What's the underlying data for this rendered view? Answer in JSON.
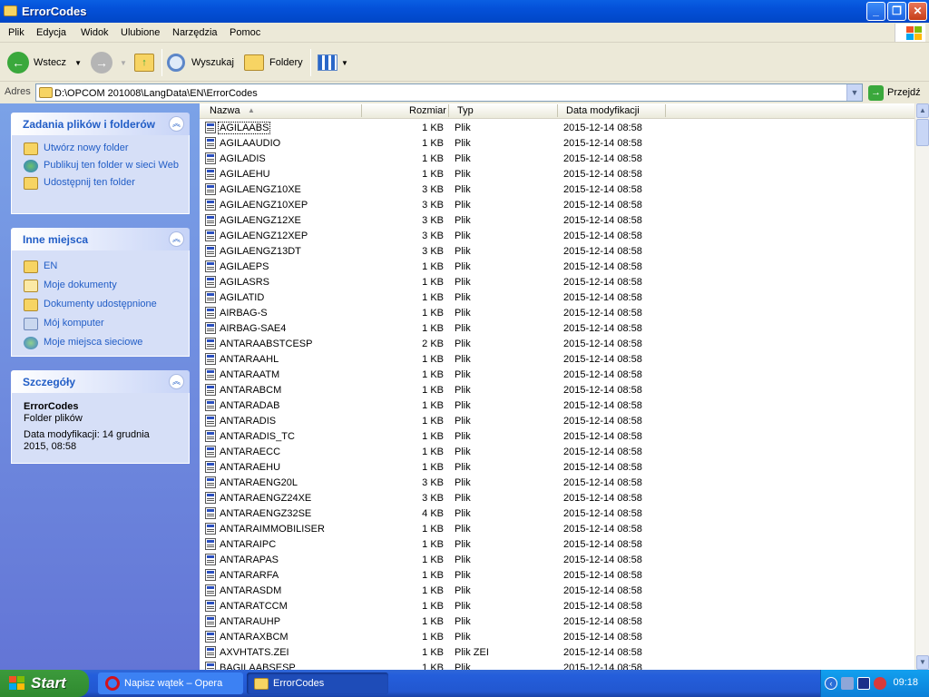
{
  "window": {
    "title": "ErrorCodes",
    "controls": [
      "minimize",
      "maximize",
      "close"
    ]
  },
  "menu": [
    "Plik",
    "Edycja",
    "Widok",
    "Ulubione",
    "Narzędzia",
    "Pomoc"
  ],
  "toolbar": {
    "back_label": "Wstecz",
    "search_label": "Wyszukaj",
    "folders_label": "Foldery"
  },
  "address": {
    "label": "Adres",
    "path": "D:\\OPCOM 201008\\LangData\\EN\\ErrorCodes",
    "go_label": "Przejdź"
  },
  "tasks_panel": {
    "title": "Zadania plików i folderów",
    "items": [
      "Utwórz nowy folder",
      "Publikuj ten folder w sieci Web",
      "Udostępnij ten folder"
    ]
  },
  "places_panel": {
    "title": "Inne miejsca",
    "items": [
      "EN",
      "Moje dokumenty",
      "Dokumenty udostępnione",
      "Mój komputer",
      "Moje miejsca sieciowe"
    ]
  },
  "details_panel": {
    "title": "Szczegóły",
    "name": "ErrorCodes",
    "type": "Folder plików",
    "modified": "Data modyfikacji: 14 grudnia 2015, 08:58"
  },
  "columns": [
    "Nazwa",
    "Rozmiar",
    "Typ",
    "Data modyfikacji"
  ],
  "files": [
    {
      "name": "AGILAABS",
      "size": "1 KB",
      "type": "Plik",
      "date": "2015-12-14 08:58"
    },
    {
      "name": "AGILAAUDIO",
      "size": "1 KB",
      "type": "Plik",
      "date": "2015-12-14 08:58"
    },
    {
      "name": "AGILADIS",
      "size": "1 KB",
      "type": "Plik",
      "date": "2015-12-14 08:58"
    },
    {
      "name": "AGILAEHU",
      "size": "1 KB",
      "type": "Plik",
      "date": "2015-12-14 08:58"
    },
    {
      "name": "AGILAENGZ10XE",
      "size": "3 KB",
      "type": "Plik",
      "date": "2015-12-14 08:58"
    },
    {
      "name": "AGILAENGZ10XEP",
      "size": "3 KB",
      "type": "Plik",
      "date": "2015-12-14 08:58"
    },
    {
      "name": "AGILAENGZ12XE",
      "size": "3 KB",
      "type": "Plik",
      "date": "2015-12-14 08:58"
    },
    {
      "name": "AGILAENGZ12XEP",
      "size": "3 KB",
      "type": "Plik",
      "date": "2015-12-14 08:58"
    },
    {
      "name": "AGILAENGZ13DT",
      "size": "3 KB",
      "type": "Plik",
      "date": "2015-12-14 08:58"
    },
    {
      "name": "AGILAEPS",
      "size": "1 KB",
      "type": "Plik",
      "date": "2015-12-14 08:58"
    },
    {
      "name": "AGILASRS",
      "size": "1 KB",
      "type": "Plik",
      "date": "2015-12-14 08:58"
    },
    {
      "name": "AGILATID",
      "size": "1 KB",
      "type": "Plik",
      "date": "2015-12-14 08:58"
    },
    {
      "name": "AIRBAG-S",
      "size": "1 KB",
      "type": "Plik",
      "date": "2015-12-14 08:58"
    },
    {
      "name": "AIRBAG-SAE4",
      "size": "1 KB",
      "type": "Plik",
      "date": "2015-12-14 08:58"
    },
    {
      "name": "ANTARAABSTCESP",
      "size": "2 KB",
      "type": "Plik",
      "date": "2015-12-14 08:58"
    },
    {
      "name": "ANTARAAHL",
      "size": "1 KB",
      "type": "Plik",
      "date": "2015-12-14 08:58"
    },
    {
      "name": "ANTARAATM",
      "size": "1 KB",
      "type": "Plik",
      "date": "2015-12-14 08:58"
    },
    {
      "name": "ANTARABCM",
      "size": "1 KB",
      "type": "Plik",
      "date": "2015-12-14 08:58"
    },
    {
      "name": "ANTARADAB",
      "size": "1 KB",
      "type": "Plik",
      "date": "2015-12-14 08:58"
    },
    {
      "name": "ANTARADIS",
      "size": "1 KB",
      "type": "Plik",
      "date": "2015-12-14 08:58"
    },
    {
      "name": "ANTARADIS_TC",
      "size": "1 KB",
      "type": "Plik",
      "date": "2015-12-14 08:58"
    },
    {
      "name": "ANTARAECC",
      "size": "1 KB",
      "type": "Plik",
      "date": "2015-12-14 08:58"
    },
    {
      "name": "ANTARAEHU",
      "size": "1 KB",
      "type": "Plik",
      "date": "2015-12-14 08:58"
    },
    {
      "name": "ANTARAENG20L",
      "size": "3 KB",
      "type": "Plik",
      "date": "2015-12-14 08:58"
    },
    {
      "name": "ANTARAENGZ24XE",
      "size": "3 KB",
      "type": "Plik",
      "date": "2015-12-14 08:58"
    },
    {
      "name": "ANTARAENGZ32SE",
      "size": "4 KB",
      "type": "Plik",
      "date": "2015-12-14 08:58"
    },
    {
      "name": "ANTARAIMMOBILISER",
      "size": "1 KB",
      "type": "Plik",
      "date": "2015-12-14 08:58"
    },
    {
      "name": "ANTARAIPC",
      "size": "1 KB",
      "type": "Plik",
      "date": "2015-12-14 08:58"
    },
    {
      "name": "ANTARAPAS",
      "size": "1 KB",
      "type": "Plik",
      "date": "2015-12-14 08:58"
    },
    {
      "name": "ANTARARFA",
      "size": "1 KB",
      "type": "Plik",
      "date": "2015-12-14 08:58"
    },
    {
      "name": "ANTARASDM",
      "size": "1 KB",
      "type": "Plik",
      "date": "2015-12-14 08:58"
    },
    {
      "name": "ANTARATCCM",
      "size": "1 KB",
      "type": "Plik",
      "date": "2015-12-14 08:58"
    },
    {
      "name": "ANTARAUHP",
      "size": "1 KB",
      "type": "Plik",
      "date": "2015-12-14 08:58"
    },
    {
      "name": "ANTARAXBCM",
      "size": "1 KB",
      "type": "Plik",
      "date": "2015-12-14 08:58"
    },
    {
      "name": "AXVHTATS.ZEI",
      "size": "1 KB",
      "type": "Plik ZEI",
      "date": "2015-12-14 08:58"
    },
    {
      "name": "BAGILAABSESP",
      "size": "1 KB",
      "type": "Plik",
      "date": "2015-12-14 08:58"
    }
  ],
  "taskbar": {
    "start_label": "Start",
    "tasks": [
      "Napisz wątek – Opera",
      "ErrorCodes"
    ],
    "clock": "09:18"
  },
  "colors": {
    "title_blue": "#0450d8",
    "link_blue": "#215dc6",
    "start_green": "#2f8a2f"
  }
}
